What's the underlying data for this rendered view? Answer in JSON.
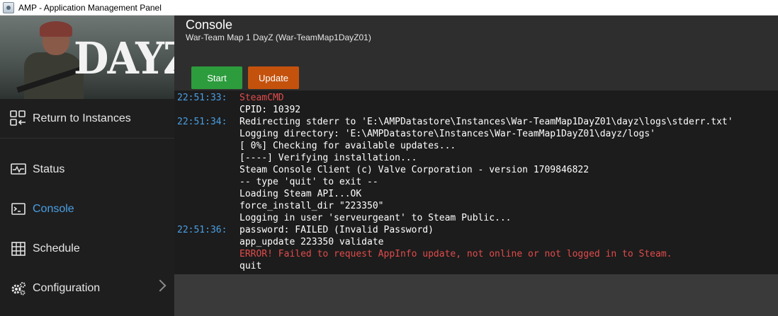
{
  "window": {
    "title": "AMP - Application Management Panel"
  },
  "banner": {
    "logo_text": "DAYZ"
  },
  "sidebar": {
    "return_label": "Return to Instances",
    "items": [
      {
        "label": "Status",
        "icon": "monitor-pulse-icon"
      },
      {
        "label": "Console",
        "icon": "terminal-icon",
        "active": true
      },
      {
        "label": "Schedule",
        "icon": "calendar-grid-icon"
      },
      {
        "label": "Configuration",
        "icon": "gears-icon"
      }
    ]
  },
  "header": {
    "title": "Console",
    "subtitle": "War-Team Map 1 DayZ (War-TeamMap1DayZ01)"
  },
  "toolbar": {
    "start_label": "Start",
    "update_label": "Update"
  },
  "console": {
    "lines": [
      {
        "time": "22:51:33:",
        "text": "SteamCMD",
        "error": true
      },
      {
        "time": "",
        "text": "CPID: 10392"
      },
      {
        "time": "22:51:34:",
        "text": "Redirecting stderr to 'E:\\AMPDatastore\\Instances\\War-TeamMap1DayZ01\\dayz\\logs\\stderr.txt'"
      },
      {
        "time": "",
        "text": "Logging directory: 'E:\\AMPDatastore\\Instances\\War-TeamMap1DayZ01\\dayz/logs'"
      },
      {
        "time": "",
        "text": "[ 0%] Checking for available updates..."
      },
      {
        "time": "",
        "text": "[----] Verifying installation..."
      },
      {
        "time": "",
        "text": "Steam Console Client (c) Valve Corporation - version 1709846822"
      },
      {
        "time": "",
        "text": "-- type 'quit' to exit --"
      },
      {
        "time": "",
        "text": "Loading Steam API...OK"
      },
      {
        "time": "",
        "text": "force_install_dir \"223350\""
      },
      {
        "time": "",
        "text": "Logging in user 'serveurgeant' to Steam Public..."
      },
      {
        "time": "22:51:36:",
        "text": "password: FAILED (Invalid Password)"
      },
      {
        "time": "",
        "text": "app_update 223350 validate"
      },
      {
        "time": "",
        "text": "ERROR! Failed to request AppInfo update, not online or not logged in to Steam.",
        "error": true
      },
      {
        "time": "",
        "text": "quit"
      }
    ]
  },
  "colors": {
    "accent": "#4a9fe3",
    "start": "#2c9c3d",
    "update": "#c4520d",
    "error": "#e24b4b"
  }
}
